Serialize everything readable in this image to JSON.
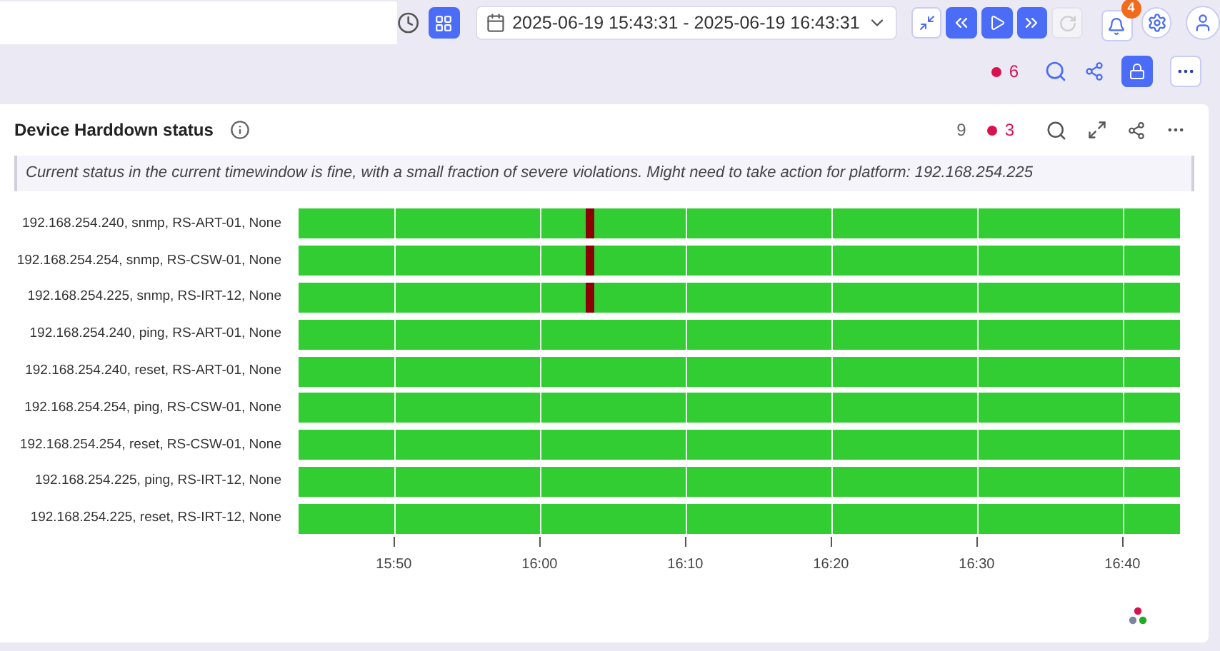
{
  "toolbar": {
    "date_range": "2025-06-19 15:43:31 - 2025-06-19 16:43:31",
    "notifications_badge": "4",
    "view_toggle_selected": true
  },
  "sub_toolbar": {
    "alert_count": "6",
    "lock_selected": true
  },
  "panel": {
    "title": "Device Harddown status",
    "count": "9",
    "alert_count": "3",
    "message": "Current status in the current timewindow is fine, with a small fraction of severe violations. Might need to take action for platform: 192.168.254.225",
    "timeline": {
      "axis_ticks": [
        "15:50",
        "16:00",
        "16:10",
        "16:20",
        "16:30",
        "16:40"
      ],
      "rows": [
        {
          "label": "192.168.254.240, snmp, RS-ART-01, None",
          "severe": true,
          "level": 0.33
        },
        {
          "label": "192.168.254.254, snmp, RS-CSW-01, None",
          "severe": true,
          "level": 0.33
        },
        {
          "label": "192.168.254.225, snmp, RS-IRT-12, None",
          "severe": true,
          "level": 0.33
        },
        {
          "label": "192.168.254.240, ping, RS-ART-01, None",
          "severe": false
        },
        {
          "label": "192.168.254.240, reset, RS-ART-01, None",
          "severe": false
        },
        {
          "label": "192.168.254.254, ping, RS-CSW-01, None",
          "severe": false
        },
        {
          "label": "192.168.254.254, reset, RS-CSW-01, None",
          "severe": false
        },
        {
          "label": "192.168.254.225, ping, RS-IRT-12, None",
          "severe": false
        },
        {
          "label": "192.168.254.225, reset, RS-IRT-12, None",
          "severe": false
        }
      ]
    }
  }
}
